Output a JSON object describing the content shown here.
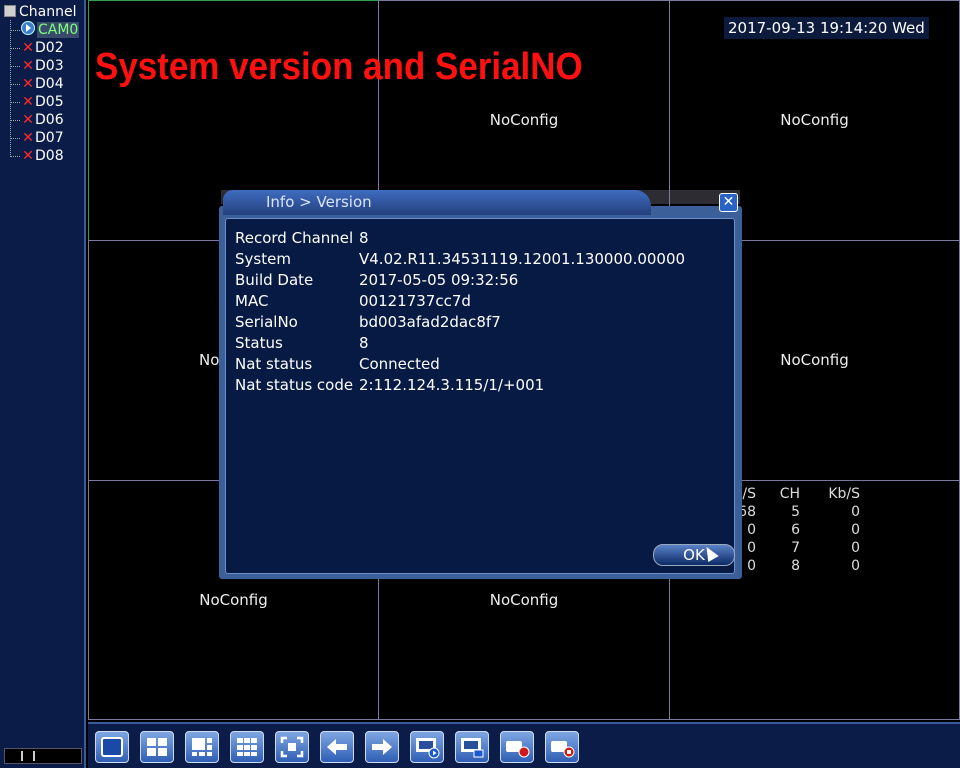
{
  "sidebar": {
    "root_label": "Channel",
    "channels": [
      {
        "label": "CAM0",
        "state": "active"
      },
      {
        "label": "D02",
        "state": "off"
      },
      {
        "label": "D03",
        "state": "off"
      },
      {
        "label": "D04",
        "state": "off"
      },
      {
        "label": "D05",
        "state": "off"
      },
      {
        "label": "D06",
        "state": "off"
      },
      {
        "label": "D07",
        "state": "off"
      },
      {
        "label": "D08",
        "state": "off"
      }
    ]
  },
  "overlay_title": "System version and SerialNO",
  "clock": "2017-09-13 19:14:20 Wed",
  "grid": {
    "noconfig_label": "NoConfig",
    "cell_partial": "No"
  },
  "stats": {
    "headers": {
      "kbs_partial": "/S",
      "ch": "CH",
      "kbs": "Kb/S"
    },
    "rows": [
      {
        "kbs1": "68",
        "ch": "5",
        "kbs2": "0"
      },
      {
        "kbs1": "0",
        "ch": "6",
        "kbs2": "0"
      },
      {
        "kbs1": "0",
        "ch": "7",
        "kbs2": "0"
      },
      {
        "kbs1": "0",
        "ch": "8",
        "kbs2": "0"
      }
    ]
  },
  "dialog": {
    "title": "Info > Version",
    "close_icon": "close-icon",
    "rows": [
      {
        "key": "Record Channel",
        "value": "8"
      },
      {
        "key": "System",
        "value": "V4.02.R11.34531119.12001.130000.00000"
      },
      {
        "key": "Build Date",
        "value": "2017-05-05 09:32:56"
      },
      {
        "key": "MAC",
        "value": "00121737cc7d"
      },
      {
        "key": "SerialNo",
        "value": "bd003afad2dac8f7"
      },
      {
        "key": "Status",
        "value": "8"
      },
      {
        "key": "Nat status",
        "value": "Connected"
      },
      {
        "key": "Nat status code",
        "value": "2:112.124.3.115/1/+001"
      }
    ],
    "ok_label": "OK"
  },
  "taskbar": {
    "buttons": [
      "single-view-icon",
      "quad-view-icon",
      "six-view-icon",
      "nine-view-icon",
      "fullscreen-icon",
      "previous-icon",
      "next-icon",
      "playback-icon",
      "remote-device-icon",
      "record-icon",
      "stop-record-icon"
    ]
  },
  "colors": {
    "overlay_red": "#ff1010",
    "active_channel": "#7fff7f",
    "selected_cell_border": "#2ea24a"
  }
}
